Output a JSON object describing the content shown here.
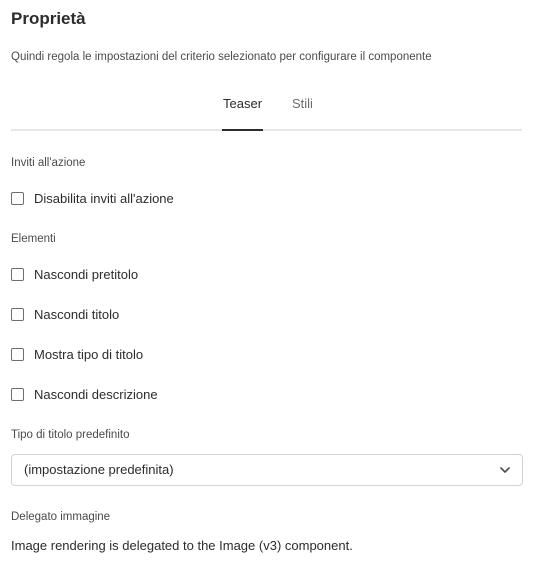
{
  "panel": {
    "title": "Proprietà",
    "description": "Quindi regola le impostazioni del criterio selezionato per configurare il componente"
  },
  "tabs": [
    {
      "label": "Teaser",
      "selected": true
    },
    {
      "label": "Stili",
      "selected": false
    }
  ],
  "cta_section": {
    "label": "Inviti all'azione",
    "checkboxes": [
      {
        "label": "Disabilita inviti all'azione",
        "checked": false
      }
    ]
  },
  "elements_section": {
    "label": "Elementi",
    "checkboxes": [
      {
        "label": "Nascondi pretitolo",
        "checked": false
      },
      {
        "label": "Nascondi titolo",
        "checked": false
      },
      {
        "label": "Mostra tipo di titolo",
        "checked": false
      },
      {
        "label": "Nascondi descrizione",
        "checked": false
      }
    ]
  },
  "title_type": {
    "label": "Tipo di titolo predefinito",
    "selected_value": "(impostazione predefinita)",
    "icon": "chevron-down-icon"
  },
  "image_delegate": {
    "label": "Delegato immagine",
    "text": "Image rendering is delegated to the Image (v3) component."
  },
  "colors": {
    "text_primary": "#2c2c2c",
    "text_secondary": "#4b4b4b",
    "tab_inactive": "#6e6e6e",
    "divider": "#e6e6e6",
    "border": "#d3d3d3"
  }
}
